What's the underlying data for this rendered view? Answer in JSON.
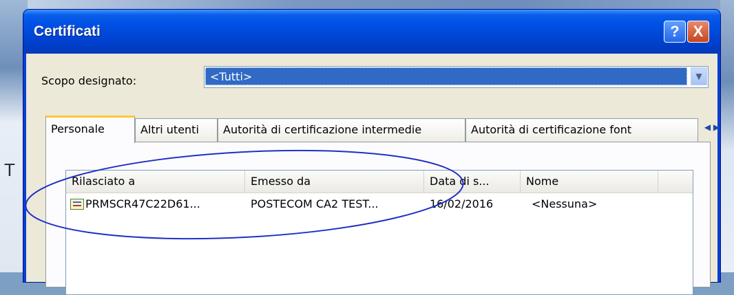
{
  "dialog": {
    "title": "Certificati",
    "help_label": "?",
    "close_label": "X"
  },
  "scope": {
    "label": "Scopo designato:",
    "value": "<Tutti>"
  },
  "tabs": [
    {
      "label": "Personale",
      "active": true
    },
    {
      "label": "Altri utenti",
      "active": false
    },
    {
      "label": "Autorità di certificazione intermedie",
      "active": false
    },
    {
      "label": "Autorità di certificazione font",
      "active": false
    }
  ],
  "list": {
    "columns": [
      "Rilasciato a",
      "Emesso da",
      "Data di s...",
      "Nome"
    ],
    "rows": [
      {
        "issued_to": "PRMSCR47C22D61...",
        "issued_by": "POSTECOM CA2 TEST...",
        "date": "16/02/2016",
        "name": "<Nessuna>",
        "icon": "certificate-icon"
      }
    ]
  },
  "colors": {
    "selection": "#316ac5",
    "annotation": "#1f2fc6"
  }
}
